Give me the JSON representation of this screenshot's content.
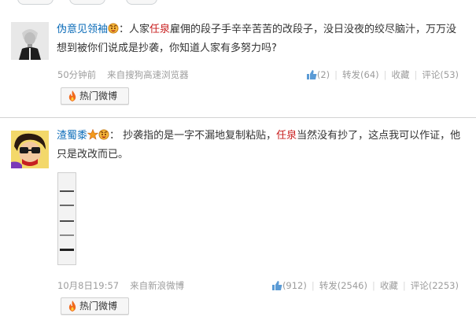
{
  "posts": [
    {
      "username": "伪意见领袖",
      "text_segments": [
        "：人家",
        "任泉",
        "雇佣的段子手辛辛苦苦的改段子，没日没夜的绞尽脑汁，万万没想到被你们说成是抄袭，你知道人家有多努力吗?"
      ],
      "time": "50分钟前",
      "source": "来自搜狗高速浏览器",
      "like_count": "(2)",
      "repost_label": "转发(64)",
      "favorite_label": "收藏",
      "comment_label": "评论(53)",
      "hot_button": "热门微博"
    },
    {
      "username": "渣蜀黍",
      "text_segments": [
        "： 抄袭指的是一字不漏地复制粘贴，",
        "任泉",
        "当然没有抄了，这点我可以作证，他只是改改而已。"
      ],
      "time": "10月8日19:57",
      "source": "来自新浪微博",
      "like_count": "(912)",
      "repost_label": "转发(2546)",
      "favorite_label": "收藏",
      "comment_label": "评论(2253)",
      "hot_button": "热门微博"
    }
  ],
  "colors": {
    "username": "#0a6bb8",
    "highlight": "#c81e1e",
    "meta": "#9c9c9c"
  },
  "icons": [
    "like-thumb-icon",
    "fire-icon",
    "emoji-face-icon",
    "vip-star-icon"
  ]
}
